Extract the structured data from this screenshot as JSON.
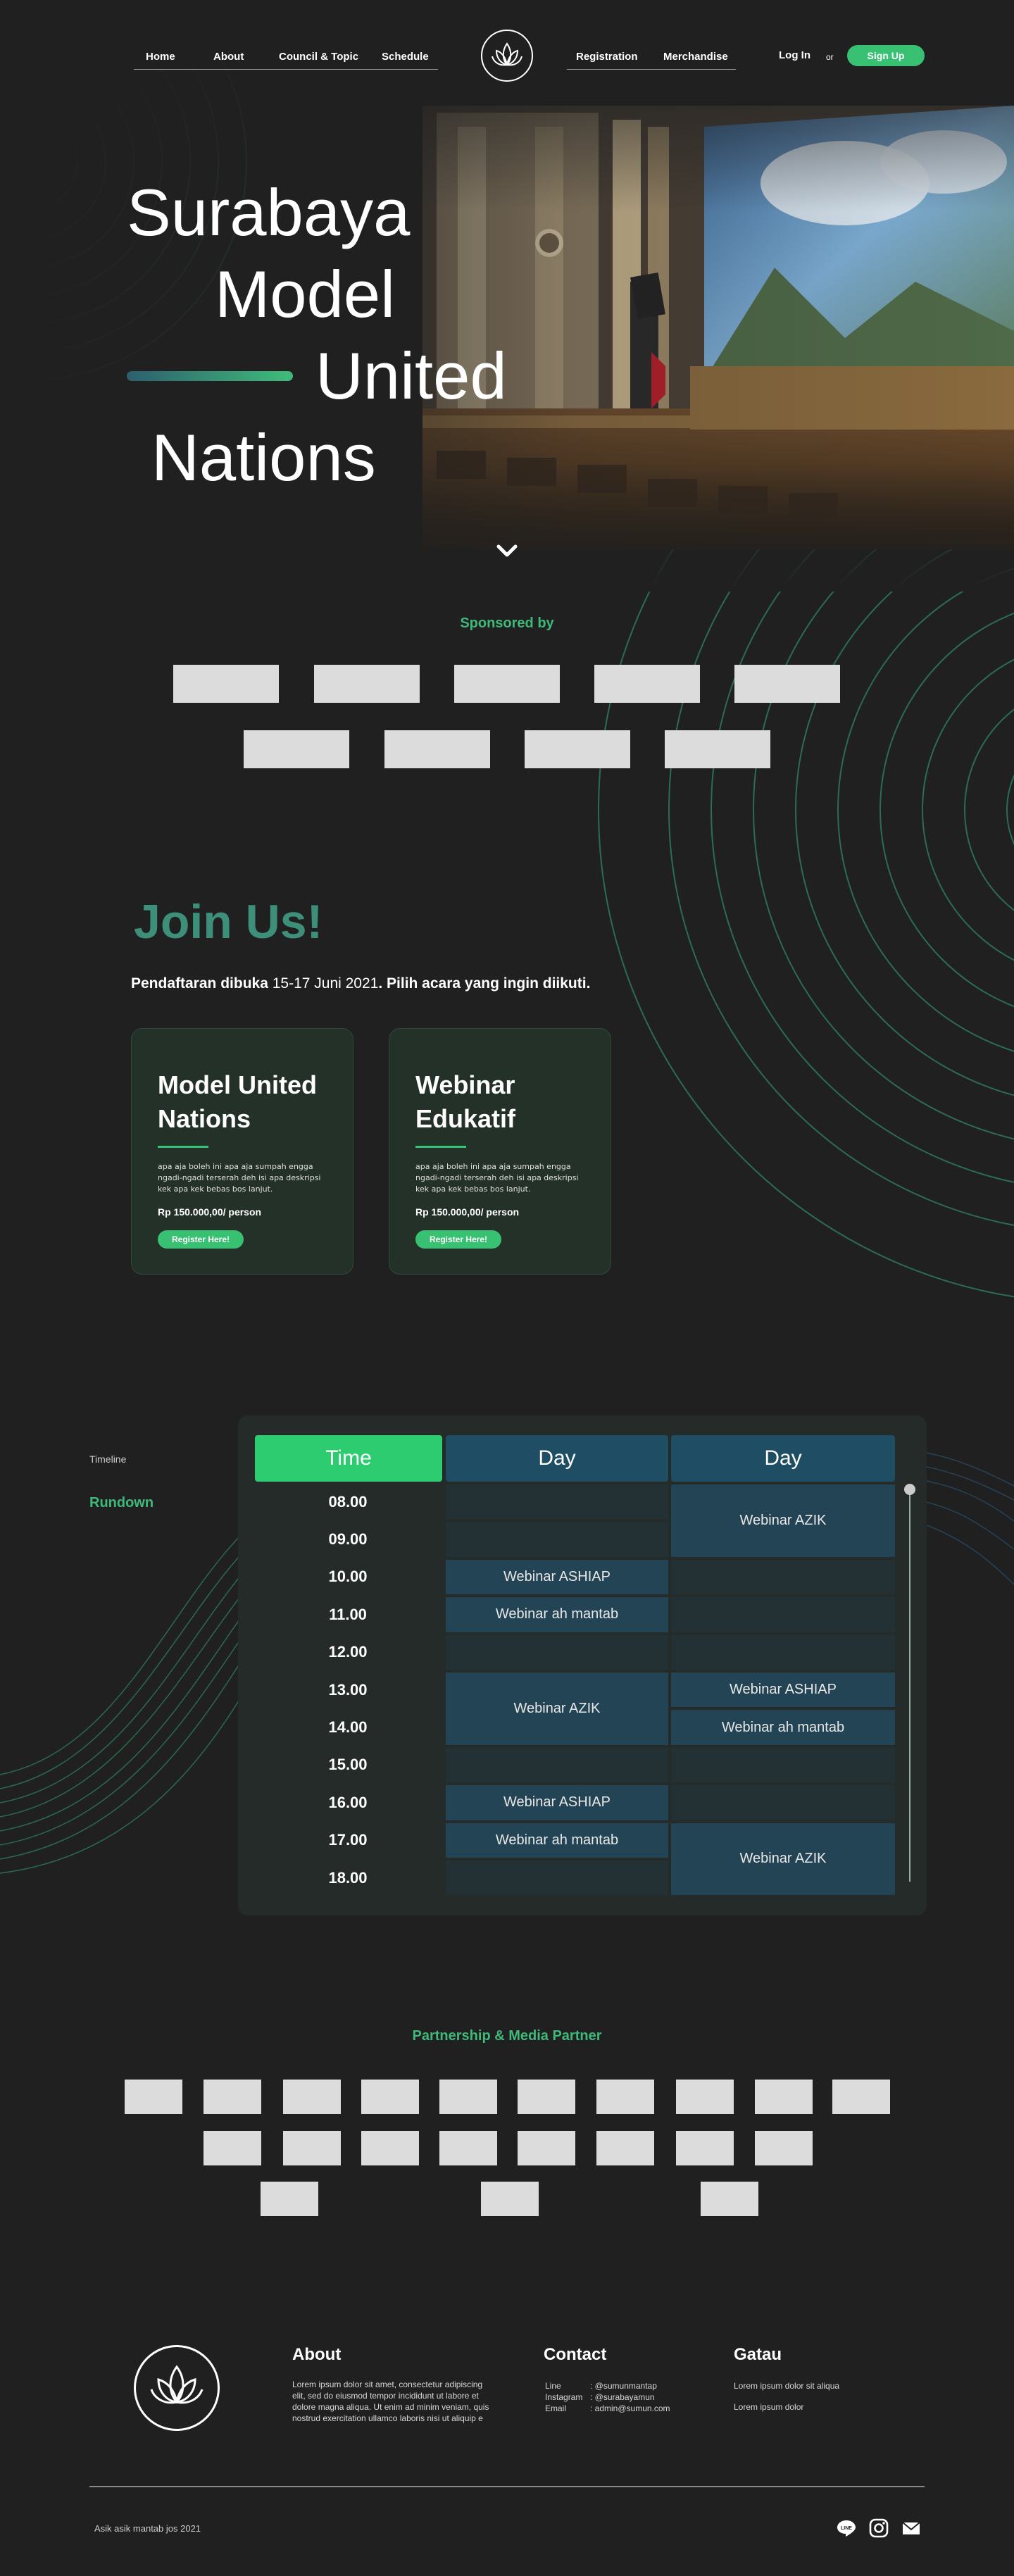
{
  "nav": {
    "left": [
      "Home",
      "About",
      "Council & Topic",
      "Schedule"
    ],
    "right": [
      "Registration",
      "Merchandise"
    ],
    "login": "Log In",
    "or": "or",
    "signup": "Sign Up"
  },
  "hero": {
    "title_lines": [
      "Surabaya",
      "Model",
      "United",
      "Nations"
    ]
  },
  "sponsors": {
    "label": "Sponsored by"
  },
  "join": {
    "title": "Join Us!",
    "subtitle_pre": "Pendaftaran dibuka ",
    "subtitle_date": "15-17 Juni 2021",
    "subtitle_post": ". Pilih acara yang ingin diikuti.",
    "cards": [
      {
        "title": "Model United Nations",
        "desc": "apa aja boleh ini apa aja sumpah engga ngadi-ngadi terserah deh isi apa deskripsi kek apa kek bebas bos lanjut.",
        "price": "Rp 150.000,00/ person",
        "button": "Register Here!"
      },
      {
        "title": "Webinar Edukatif",
        "desc": "apa aja boleh ini apa aja sumpah engga ngadi-ngadi terserah deh isi apa deskripsi kek apa kek bebas bos lanjut.",
        "price": "Rp 150.000,00/ person",
        "button": "Register Here!"
      }
    ]
  },
  "timeline": {
    "small_label": "Timeline",
    "big_label": "Rundown",
    "headers": [
      "Time",
      "Day",
      "Day"
    ],
    "times": [
      "08.00",
      "09.00",
      "10.00",
      "11.00",
      "12.00",
      "13.00",
      "14.00",
      "15.00",
      "16.00",
      "17.00",
      "18.00"
    ],
    "day1": [
      {
        "label": "",
        "start": 0,
        "span": 1
      },
      {
        "label": "",
        "start": 1,
        "span": 1
      },
      {
        "label": "Webinar ASHIAP",
        "start": 2,
        "span": 1
      },
      {
        "label": "Webinar ah mantab",
        "start": 3,
        "span": 1
      },
      {
        "label": "",
        "start": 4,
        "span": 1
      },
      {
        "label": "Webinar AZIK",
        "start": 5,
        "span": 2
      },
      {
        "label": "",
        "start": 7,
        "span": 1
      },
      {
        "label": "Webinar ASHIAP",
        "start": 8,
        "span": 1
      },
      {
        "label": "Webinar ah mantab",
        "start": 9,
        "span": 1
      },
      {
        "label": "",
        "start": 10,
        "span": 1
      }
    ],
    "day2": [
      {
        "label": "Webinar AZIK",
        "start": 0,
        "span": 2
      },
      {
        "label": "",
        "start": 2,
        "span": 1
      },
      {
        "label": "",
        "start": 3,
        "span": 1
      },
      {
        "label": "",
        "start": 4,
        "span": 1
      },
      {
        "label": "Webinar ASHIAP",
        "start": 5,
        "span": 1
      },
      {
        "label": "Webinar ah mantab",
        "start": 6,
        "span": 1
      },
      {
        "label": "",
        "start": 7,
        "span": 1
      },
      {
        "label": "",
        "start": 8,
        "span": 1
      },
      {
        "label": "Webinar AZIK",
        "start": 9,
        "span": 2
      }
    ]
  },
  "partners": {
    "label": "Partnership & Media Partner"
  },
  "footer": {
    "about_head": "About",
    "about_text": "Lorem ipsum dolor sit amet, consectetur adipiscing elit, sed do eiusmod tempor incididunt ut labore et dolore magna aliqua. Ut enim ad minim veniam, quis nostrud exercitation ullamco laboris nisi ut aliquip e",
    "contact_head": "Contact",
    "contacts": [
      {
        "k": "Line",
        "v": ": @sumunmantap"
      },
      {
        "k": "Instagram",
        "v": ": @surabayamun"
      },
      {
        "k": "Email",
        "v": ": admin@sumun.com"
      }
    ],
    "gatau_head": "Gatau",
    "gatau_lines": [
      "Lorem ipsum dolor sit  aliqua",
      "Lorem ipsum dolor"
    ],
    "copyright": "Asik asik mantab jos 2021",
    "social_icons": [
      "line-icon",
      "instagram-icon",
      "mail-icon"
    ]
  },
  "colors": {
    "accent": "#38c172",
    "background": "#202020",
    "card": "#233129",
    "slot_event": "#234454",
    "header_time": "#2ecc71",
    "header_day": "#1f4d63"
  }
}
